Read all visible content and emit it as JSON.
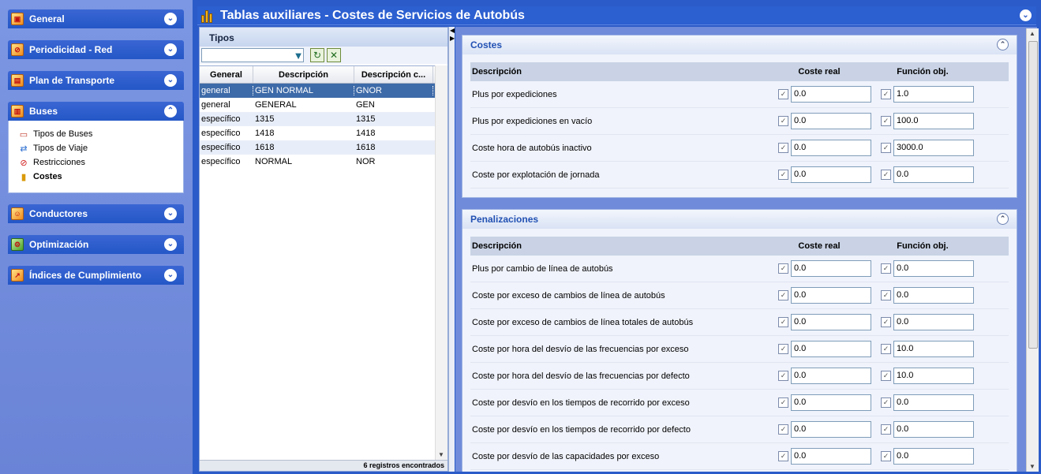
{
  "sidebar": {
    "sections": [
      {
        "label": "General",
        "icon": "general-icon"
      },
      {
        "label": "Periodicidad - Red",
        "icon": "calendar-icon"
      },
      {
        "label": "Plan de Transporte",
        "icon": "plan-icon"
      },
      {
        "label": "Buses",
        "icon": "bus-icon"
      },
      {
        "label": "Conductores",
        "icon": "driver-icon"
      },
      {
        "label": "Optimización",
        "icon": "optimization-icon"
      },
      {
        "label": "Índices de Cumplimiento",
        "icon": "chart-icon"
      }
    ],
    "buses_items": [
      {
        "label": "Tipos de Buses",
        "icon": "bus-icon"
      },
      {
        "label": "Tipos de Viaje",
        "icon": "trip-icon"
      },
      {
        "label": "Restricciones",
        "icon": "restriction-icon"
      },
      {
        "label": "Costes",
        "icon": "coins-icon",
        "active": true
      }
    ]
  },
  "title": "Tablas auxiliares - Costes de Servicios de Autobús",
  "tipos": {
    "header": "Tipos",
    "search_value": "",
    "columns": [
      "General",
      "Descripción",
      "Descripción c..."
    ],
    "rows": [
      [
        "general",
        "GEN NORMAL",
        "GNOR"
      ],
      [
        "general",
        "GENERAL",
        "GEN"
      ],
      [
        "específico",
        "1315",
        "1315"
      ],
      [
        "específico",
        "1418",
        "1418"
      ],
      [
        "específico",
        "1618",
        "1618"
      ],
      [
        "específico",
        "NORMAL",
        "NOR"
      ]
    ],
    "footer": "6 registros encontrados"
  },
  "costes": {
    "header": "Costes",
    "columns": [
      "Descripción",
      "Coste real",
      "Función obj."
    ],
    "rows": [
      {
        "desc": "Plus por expediciones",
        "real": "0.0",
        "obj": "1.0"
      },
      {
        "desc": "Plus por expediciones en vacío",
        "real": "0.0",
        "obj": "100.0"
      },
      {
        "desc": "Coste hora de autobús inactivo",
        "real": "0.0",
        "obj": "3000.0"
      },
      {
        "desc": "Coste por explotación de jornada",
        "real": "0.0",
        "obj": "0.0"
      }
    ]
  },
  "penalizaciones": {
    "header": "Penalizaciones",
    "columns": [
      "Descripción",
      "Coste real",
      "Función obj."
    ],
    "rows": [
      {
        "desc": "Plus por cambio de línea de autobús",
        "real": "0.0",
        "obj": "0.0"
      },
      {
        "desc": "Coste por exceso de cambios de línea de autobús",
        "real": "0.0",
        "obj": "0.0"
      },
      {
        "desc": "Coste por exceso de cambios de línea totales de autobús",
        "real": "0.0",
        "obj": "0.0"
      },
      {
        "desc": "Coste por hora del desvío de las frecuencias por exceso",
        "real": "0.0",
        "obj": "10.0"
      },
      {
        "desc": "Coste por hora del desvío de las frecuencias por defecto",
        "real": "0.0",
        "obj": "10.0"
      },
      {
        "desc": "Coste por desvío en los tiempos de recorrido por exceso",
        "real": "0.0",
        "obj": "0.0"
      },
      {
        "desc": "Coste por desvío en los tiempos de recorrido por defecto",
        "real": "0.0",
        "obj": "0.0"
      },
      {
        "desc": "Coste por desvío de las capacidades por exceso",
        "real": "0.0",
        "obj": "0.0"
      }
    ]
  },
  "colors": {
    "accent": "#2b5bc8",
    "selected_row": "#3d6aa8"
  }
}
